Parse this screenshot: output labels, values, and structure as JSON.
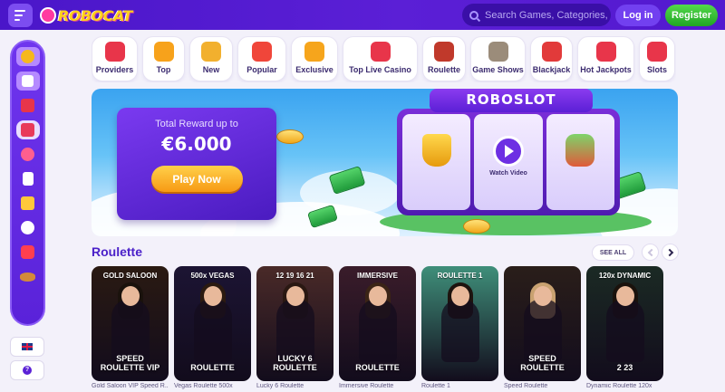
{
  "header": {
    "logo_text": "ROBOCAT",
    "search_placeholder": "Search Games, Categories, Providers",
    "login_label": "Log in",
    "register_label": "Register"
  },
  "categories": [
    {
      "label": "Providers",
      "icon": "book-icon",
      "color": "#e8354a"
    },
    {
      "label": "Top",
      "icon": "star-medal-icon",
      "color": "#f7a21b"
    },
    {
      "label": "New",
      "icon": "bell-icon",
      "color": "#f2b02e"
    },
    {
      "label": "Popular",
      "icon": "star-icon",
      "color": "#f0463a"
    },
    {
      "label": "Exclusive",
      "icon": "coin-icon",
      "color": "#f6a51c"
    },
    {
      "label": "Top Live Casino",
      "icon": "dice-icon",
      "color": "#e8354a"
    },
    {
      "label": "Roulette",
      "icon": "roulette-icon",
      "color": "#c0392b"
    },
    {
      "label": "Game Shows",
      "icon": "slot-icon",
      "color": "#9b8c7a"
    },
    {
      "label": "Blackjack",
      "icon": "cards-icon",
      "color": "#e23a3a"
    },
    {
      "label": "Hot Jackpots",
      "icon": "seven-icon",
      "color": "#e8354a"
    },
    {
      "label": "Slots",
      "icon": "cherries-icon",
      "color": "#e8354a"
    }
  ],
  "banner": {
    "reward_label": "Total Reward up to",
    "reward_amount": "€6.000",
    "play_label": "Play Now",
    "slot_title": "ROBOSLOT",
    "watch_label": "Watch Video"
  },
  "section": {
    "title": "Roulette",
    "see_all": "SEE ALL"
  },
  "games": [
    {
      "name": "Gold Saloon VIP Speed R...",
      "brand_top": "GOLD SALOON",
      "brand_bottom": "SPEED ROULETTE VIP",
      "bg": "#2a1a12",
      "hair": "#1a120c"
    },
    {
      "name": "Vegas Roulette 500x",
      "brand_top": "500x VEGAS",
      "brand_bottom": "ROULETTE",
      "bg": "#1c1433",
      "hair": "#2b1a10"
    },
    {
      "name": "Lucky 6 Roulette",
      "brand_top": "12 19 16 21",
      "brand_bottom": "LUCKY 6 ROULETTE",
      "bg": "#4a2a28",
      "hair": "#2a1812"
    },
    {
      "name": "Immersive Roulette",
      "brand_top": "IMMERSIVE",
      "brand_bottom": "ROULETTE",
      "bg": "#3a1c2a",
      "hair": "#3b2416"
    },
    {
      "name": "Roulette 1",
      "brand_top": "ROULETTE 1",
      "brand_bottom": "",
      "bg": "#3f8f7a",
      "hair": "#1e140f"
    },
    {
      "name": "Speed Roulette",
      "brand_top": "",
      "brand_bottom": "SPEED ROULETTE",
      "bg": "#2a1e1a",
      "hair": "#c9a271"
    },
    {
      "name": "Dynamic Roulette 120x",
      "brand_top": "120x DYNAMIC",
      "brand_bottom": "2 23",
      "bg": "#1b2a24",
      "hair": "#1a120c"
    }
  ]
}
